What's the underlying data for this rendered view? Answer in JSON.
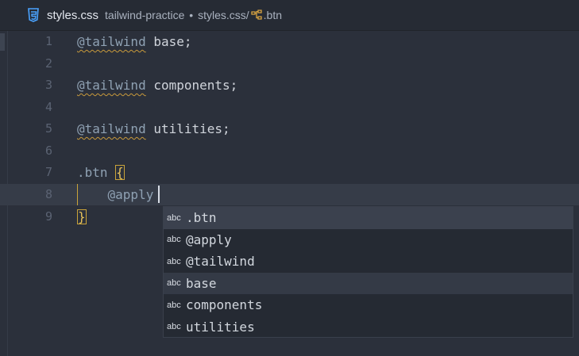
{
  "titlebar": {
    "filename": "styles.css",
    "project": "tailwind-practice",
    "separator": "•",
    "path_file": "styles.css/",
    "symbol": ".btn"
  },
  "editor": {
    "lines": [
      {
        "num": "1",
        "at": "@tailwind",
        "rest": " base;"
      },
      {
        "num": "2"
      },
      {
        "num": "3",
        "at": "@tailwind",
        "rest": " components;"
      },
      {
        "num": "4"
      },
      {
        "num": "5",
        "at": "@tailwind",
        "rest": " utilities;"
      },
      {
        "num": "6"
      },
      {
        "num": "7",
        "selector": ".btn",
        "brace": "{"
      },
      {
        "num": "8",
        "apply": "@apply"
      },
      {
        "num": "9",
        "brace": "}"
      }
    ]
  },
  "suggestions": {
    "kind_label": "abc",
    "items": [
      ".btn",
      "@apply",
      "@tailwind",
      "base",
      "components",
      "utilities"
    ]
  },
  "colors": {
    "background": "#2b303b",
    "selected_item": "#3b414e",
    "warning_underline": "#c99a3b"
  }
}
